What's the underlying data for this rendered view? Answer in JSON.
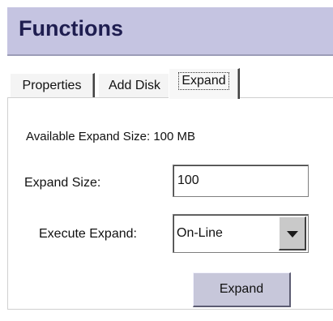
{
  "header": {
    "title": "Functions"
  },
  "tabs": [
    {
      "label": "Properties",
      "active": false
    },
    {
      "label": "Add Disk",
      "active": false
    },
    {
      "label": "Expand",
      "active": true
    }
  ],
  "expand_panel": {
    "available_text": "Available Expand Size: 100 MB",
    "size_label": "Expand Size:",
    "size_value": "100",
    "execute_label": "Execute Expand:",
    "execute_selected": "On-Line",
    "expand_button_label": "Expand"
  },
  "icons": {
    "dropdown": "chevron-down-icon"
  },
  "colors": {
    "header_bg": "#c5c4e1",
    "header_text": "#1f1e50",
    "button_bg": "#c7c7da"
  }
}
